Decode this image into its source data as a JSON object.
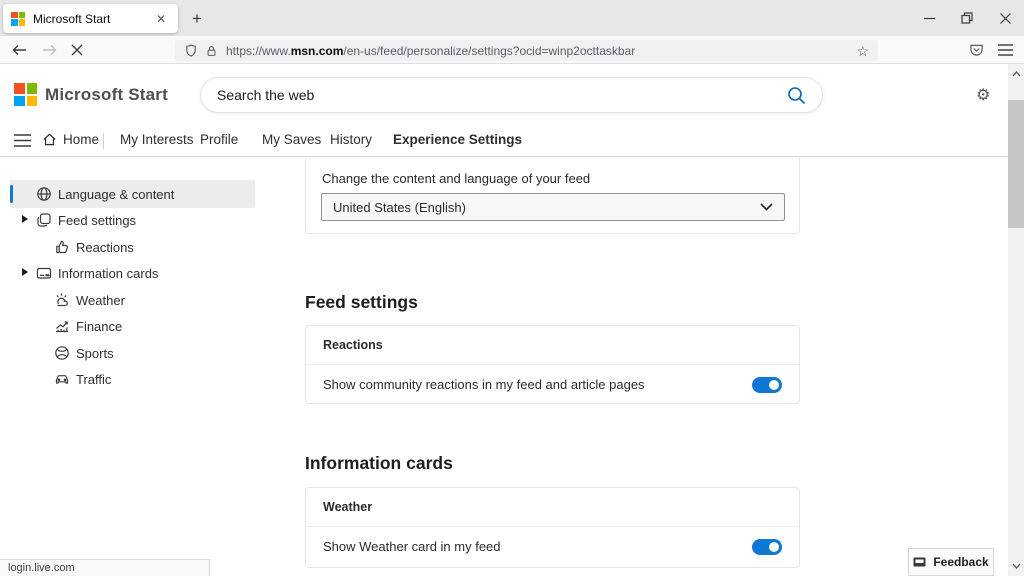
{
  "browser": {
    "tab_title": "Microsoft Start",
    "new_tab_button": "+",
    "url": {
      "prefix": "https://www.",
      "domain": "msn.com",
      "path": "/en-us/feed/personalize/settings?ocid=winp2octtaskbar"
    }
  },
  "header": {
    "brand": "Microsoft Start",
    "search_placeholder": "Search the web"
  },
  "nav": {
    "items": [
      {
        "label": "Home"
      },
      {
        "label": "My Interests"
      },
      {
        "label": "Profile"
      },
      {
        "label": "My Saves"
      },
      {
        "label": "History"
      },
      {
        "label": "Experience Settings"
      }
    ],
    "active": "Experience Settings"
  },
  "sidebar": {
    "items": [
      {
        "label": "Language & content",
        "icon": "globe-icon",
        "selected": true
      },
      {
        "label": "Feed settings",
        "icon": "feed-icon",
        "expandable": true
      },
      {
        "label": "Reactions",
        "icon": "thumbs-up-icon",
        "indented": true
      },
      {
        "label": "Information cards",
        "icon": "cards-icon",
        "expandable": true
      },
      {
        "label": "Weather",
        "icon": "weather-icon",
        "indented": true
      },
      {
        "label": "Finance",
        "icon": "finance-icon",
        "indented": true
      },
      {
        "label": "Sports",
        "icon": "sports-icon",
        "indented": true
      },
      {
        "label": "Traffic",
        "icon": "traffic-icon",
        "indented": true
      }
    ]
  },
  "content": {
    "language": {
      "label": "Change the content and language of your feed",
      "value": "United States (English)"
    },
    "feed_settings": {
      "heading": "Feed settings",
      "card_title": "Reactions",
      "toggle_label": "Show community reactions in my feed and article pages",
      "toggle_on": true
    },
    "information_cards": {
      "heading": "Information cards",
      "card_title": "Weather",
      "toggle_label": "Show Weather card in my feed",
      "toggle_on": true
    }
  },
  "status_bar": {
    "hover_link": "login.live.com"
  },
  "feedback": {
    "label": "Feedback"
  },
  "colors": {
    "accent_blue": "#0f78d4",
    "search_icon_blue": "#0067b8",
    "ms_logo": {
      "top_left": "#f25022",
      "top_right": "#7fba00",
      "bottom_left": "#00a4ef",
      "bottom_right": "#ffb900"
    }
  }
}
